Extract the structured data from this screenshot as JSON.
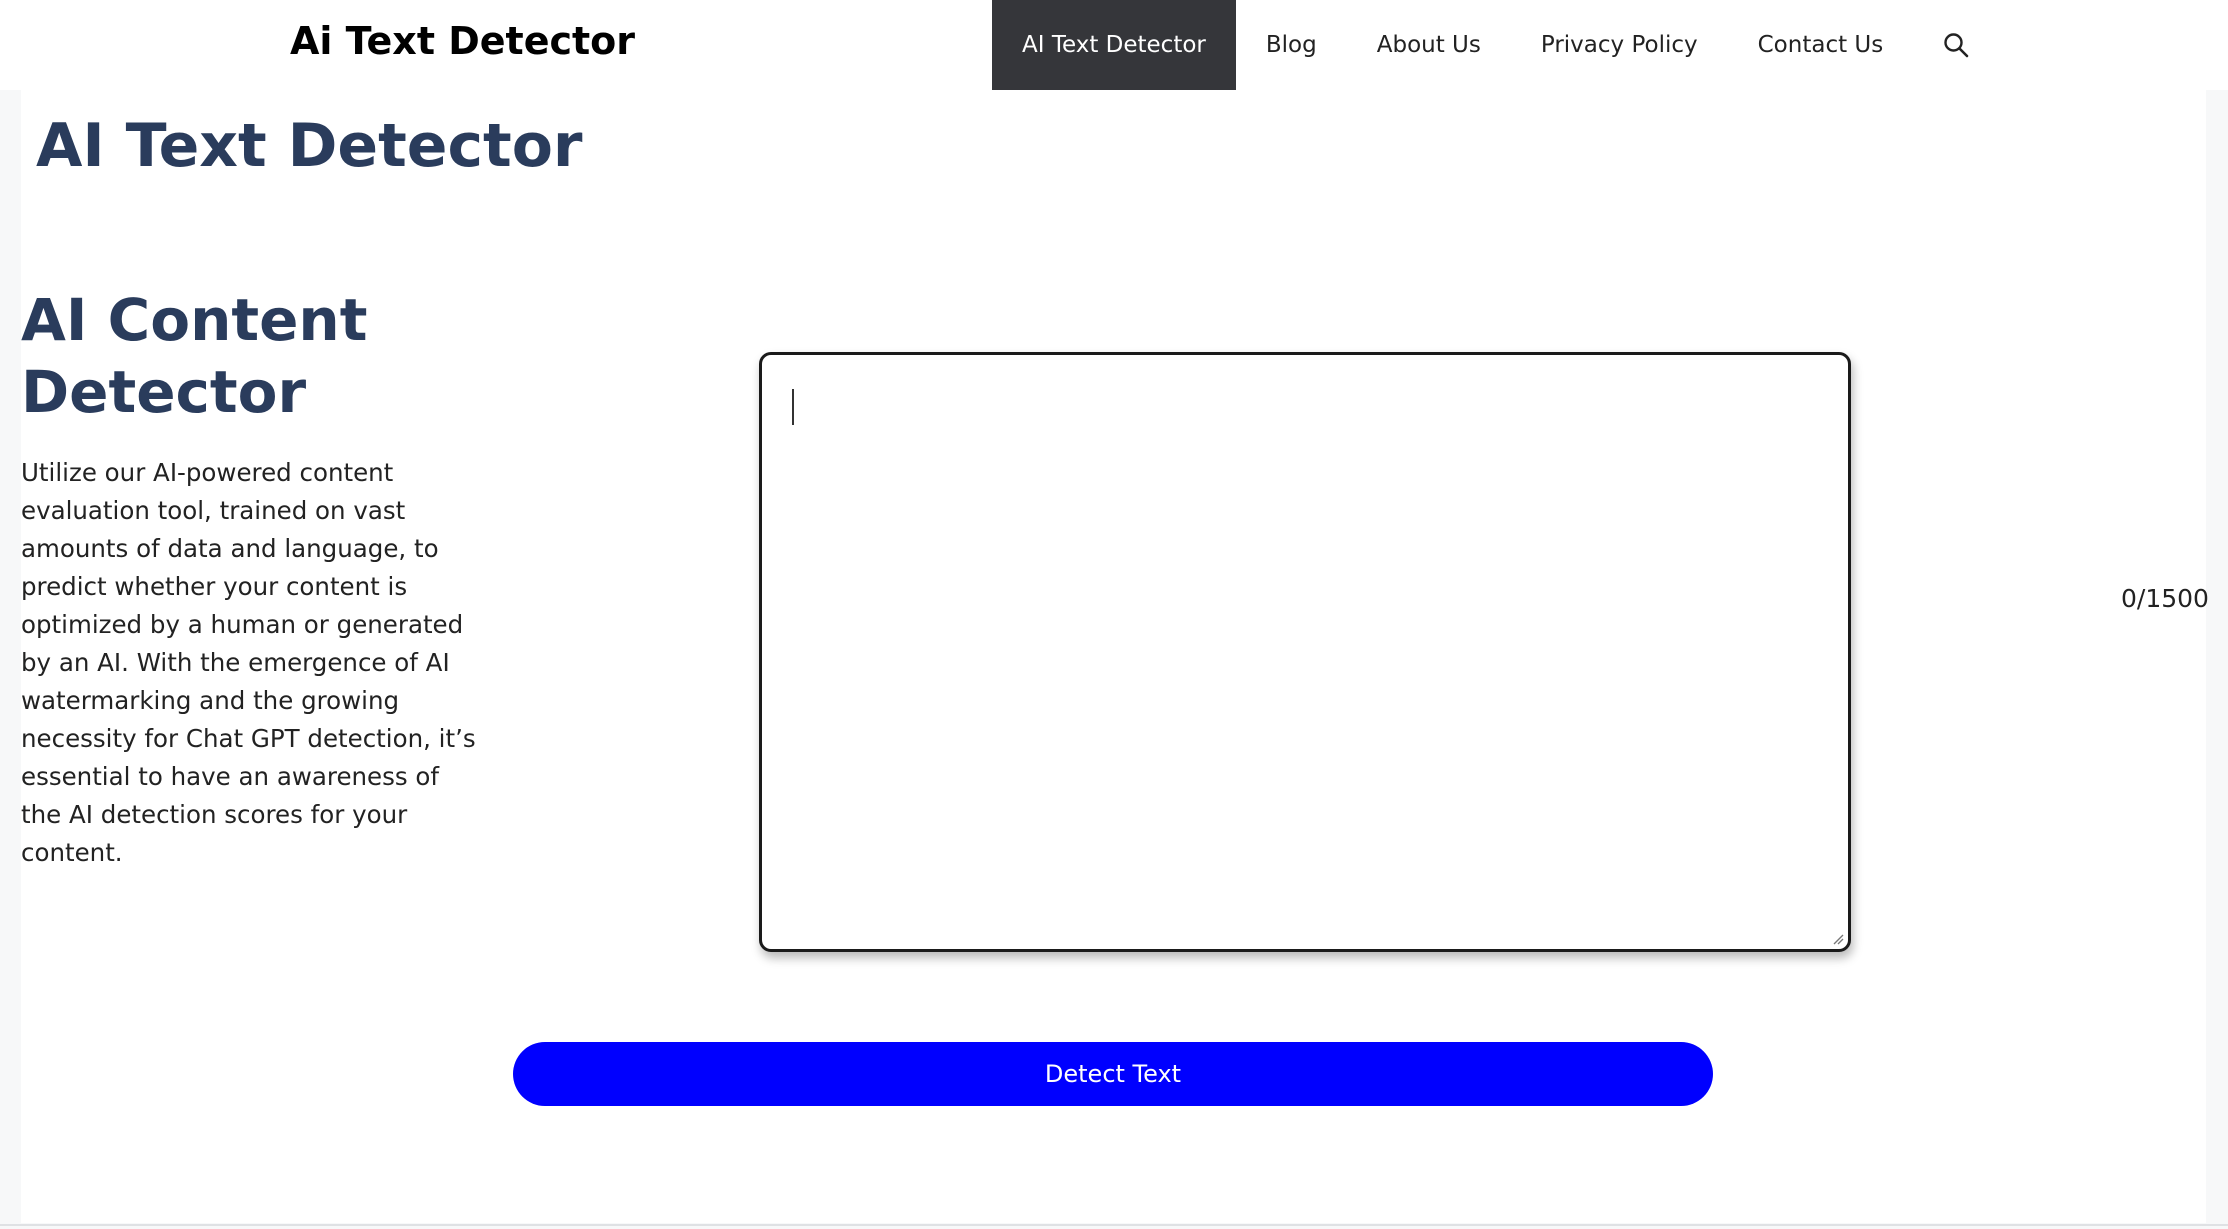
{
  "header": {
    "site_title": "Ai Text Detector",
    "nav": [
      {
        "label": "AI Text Detector",
        "active": true
      },
      {
        "label": "Blog",
        "active": false
      },
      {
        "label": "About Us",
        "active": false
      },
      {
        "label": "Privacy Policy",
        "active": false
      },
      {
        "label": "Contact Us",
        "active": false
      }
    ],
    "search_icon": "search-icon"
  },
  "main": {
    "page_title": "AI Text Detector",
    "section_heading": "AI Content Detector",
    "description": "Utilize our AI-powered content evaluation tool, trained on vast amounts of data and language, to predict whether your content is optimized by a human or generated by an AI. With the emergence of AI watermarking and the growing necessity for Chat GPT detection, it’s essential to have an awareness of the AI detection scores for your content.",
    "input": {
      "value": "",
      "placeholder": ""
    },
    "char_counter": "0/1500",
    "detect_button_label": "Detect Text"
  },
  "colors": {
    "nav_active_bg": "#35363a",
    "heading": "#2a3c5c",
    "button_bg": "#0000ff",
    "button_text": "#ffffff",
    "page_bg": "#f7f8f9"
  }
}
